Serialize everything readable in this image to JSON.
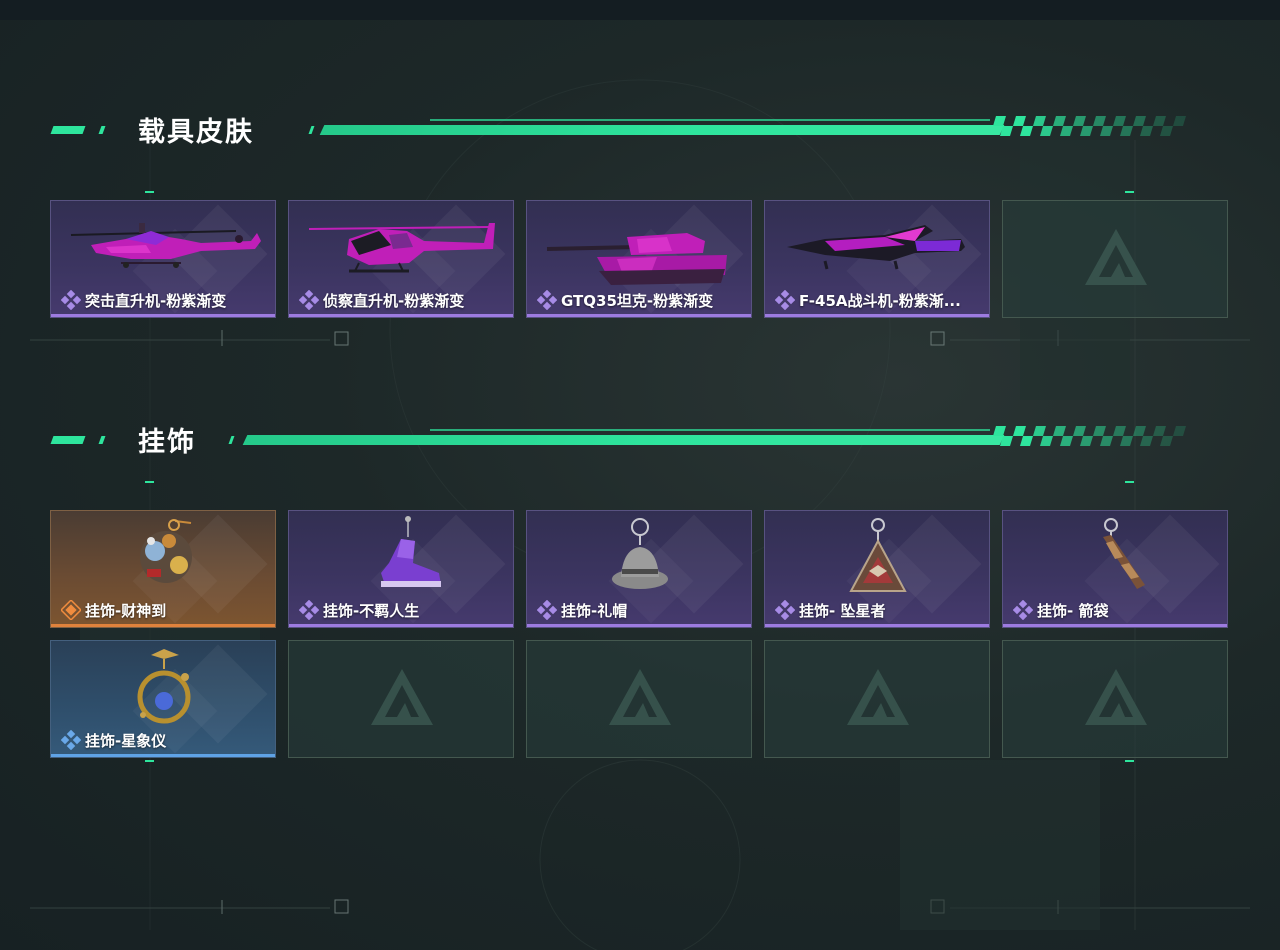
{
  "colors": {
    "accent": "#2ee59d",
    "rarity_purple": "#9d7be0",
    "rarity_orange": "#e0823c",
    "rarity_blue": "#5fa3e6"
  },
  "sections": {
    "vehicle_skins": {
      "title": "载具皮肤",
      "items": [
        {
          "label": "突击直升机-粉紫渐变",
          "rarity": "purple",
          "art": "attack-helicopter"
        },
        {
          "label": "侦察直升机-粉紫渐变",
          "rarity": "purple",
          "art": "scout-helicopter"
        },
        {
          "label": "GTQ35坦克-粉紫渐变",
          "rarity": "purple",
          "art": "tank"
        },
        {
          "label": "F-45A战斗机-粉紫渐...",
          "rarity": "purple",
          "art": "fighter-jet"
        },
        {
          "label": "",
          "rarity": "empty",
          "art": "empty"
        }
      ]
    },
    "charms": {
      "title": "挂饰",
      "items": [
        {
          "label": "挂饰-财神到",
          "rarity": "orange",
          "art": "fortune-god-charm"
        },
        {
          "label": "挂饰-不羁人生",
          "rarity": "purple",
          "art": "sneaker-charm"
        },
        {
          "label": "挂饰-礼帽",
          "rarity": "purple",
          "art": "fedora-charm"
        },
        {
          "label": "挂饰- 坠星者",
          "rarity": "purple",
          "art": "triangle-pendant-charm"
        },
        {
          "label": "挂饰- 箭袋",
          "rarity": "purple",
          "art": "quiver-charm"
        },
        {
          "label": "挂饰-星象仪",
          "rarity": "blue",
          "art": "astrolabe-charm"
        },
        {
          "label": "",
          "rarity": "empty",
          "art": "empty"
        },
        {
          "label": "",
          "rarity": "empty",
          "art": "empty"
        },
        {
          "label": "",
          "rarity": "empty",
          "art": "empty"
        },
        {
          "label": "",
          "rarity": "empty",
          "art": "empty"
        }
      ]
    }
  }
}
